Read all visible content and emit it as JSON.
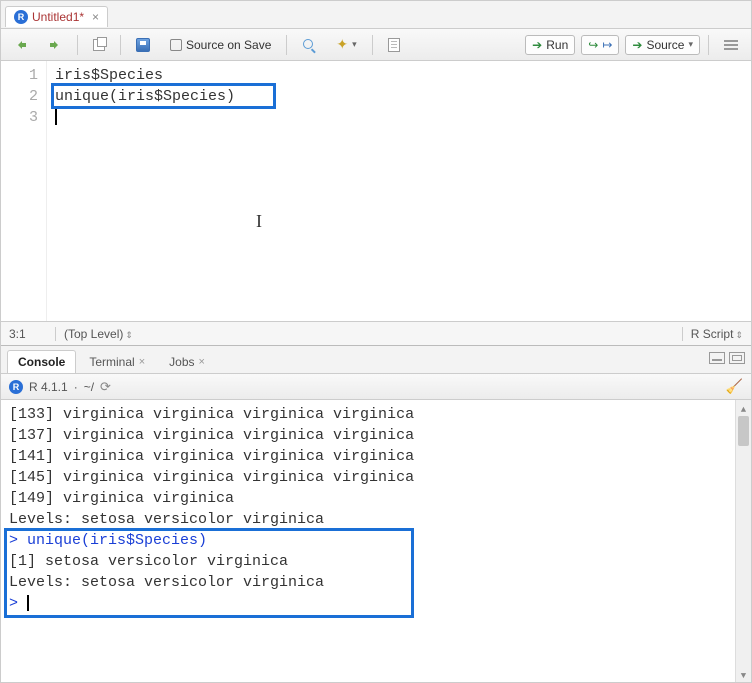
{
  "editor": {
    "tab_title": "Untitled1*",
    "toolbar": {
      "source_on_save": "Source on Save",
      "run": "Run",
      "source": "Source"
    },
    "gutter": [
      "1",
      "2",
      "3"
    ],
    "lines": {
      "l1": "iris$Species",
      "l2": "unique(iris$Species)",
      "l3": ""
    },
    "status": {
      "pos": "3:1",
      "scope": "(Top Level)",
      "lang": "R Script"
    }
  },
  "console": {
    "tabs": {
      "console": "Console",
      "terminal": "Terminal",
      "jobs": "Jobs"
    },
    "info": {
      "version": "R 4.1.1",
      "wd": "~/"
    },
    "output": {
      "r133": "[133] virginica  virginica  virginica  virginica ",
      "r137": "[137] virginica  virginica  virginica  virginica ",
      "r141": "[141] virginica  virginica  virginica  virginica ",
      "r145": "[145] virginica  virginica  virginica  virginica ",
      "r149": "[149] virginica  virginica ",
      "levels1": "Levels: setosa versicolor virginica",
      "cmd_prefix": "> ",
      "cmd": "unique(iris$Species)",
      "result": "[1] setosa     versicolor virginica ",
      "levels2": "Levels: setosa versicolor virginica",
      "prompt": "> "
    }
  }
}
